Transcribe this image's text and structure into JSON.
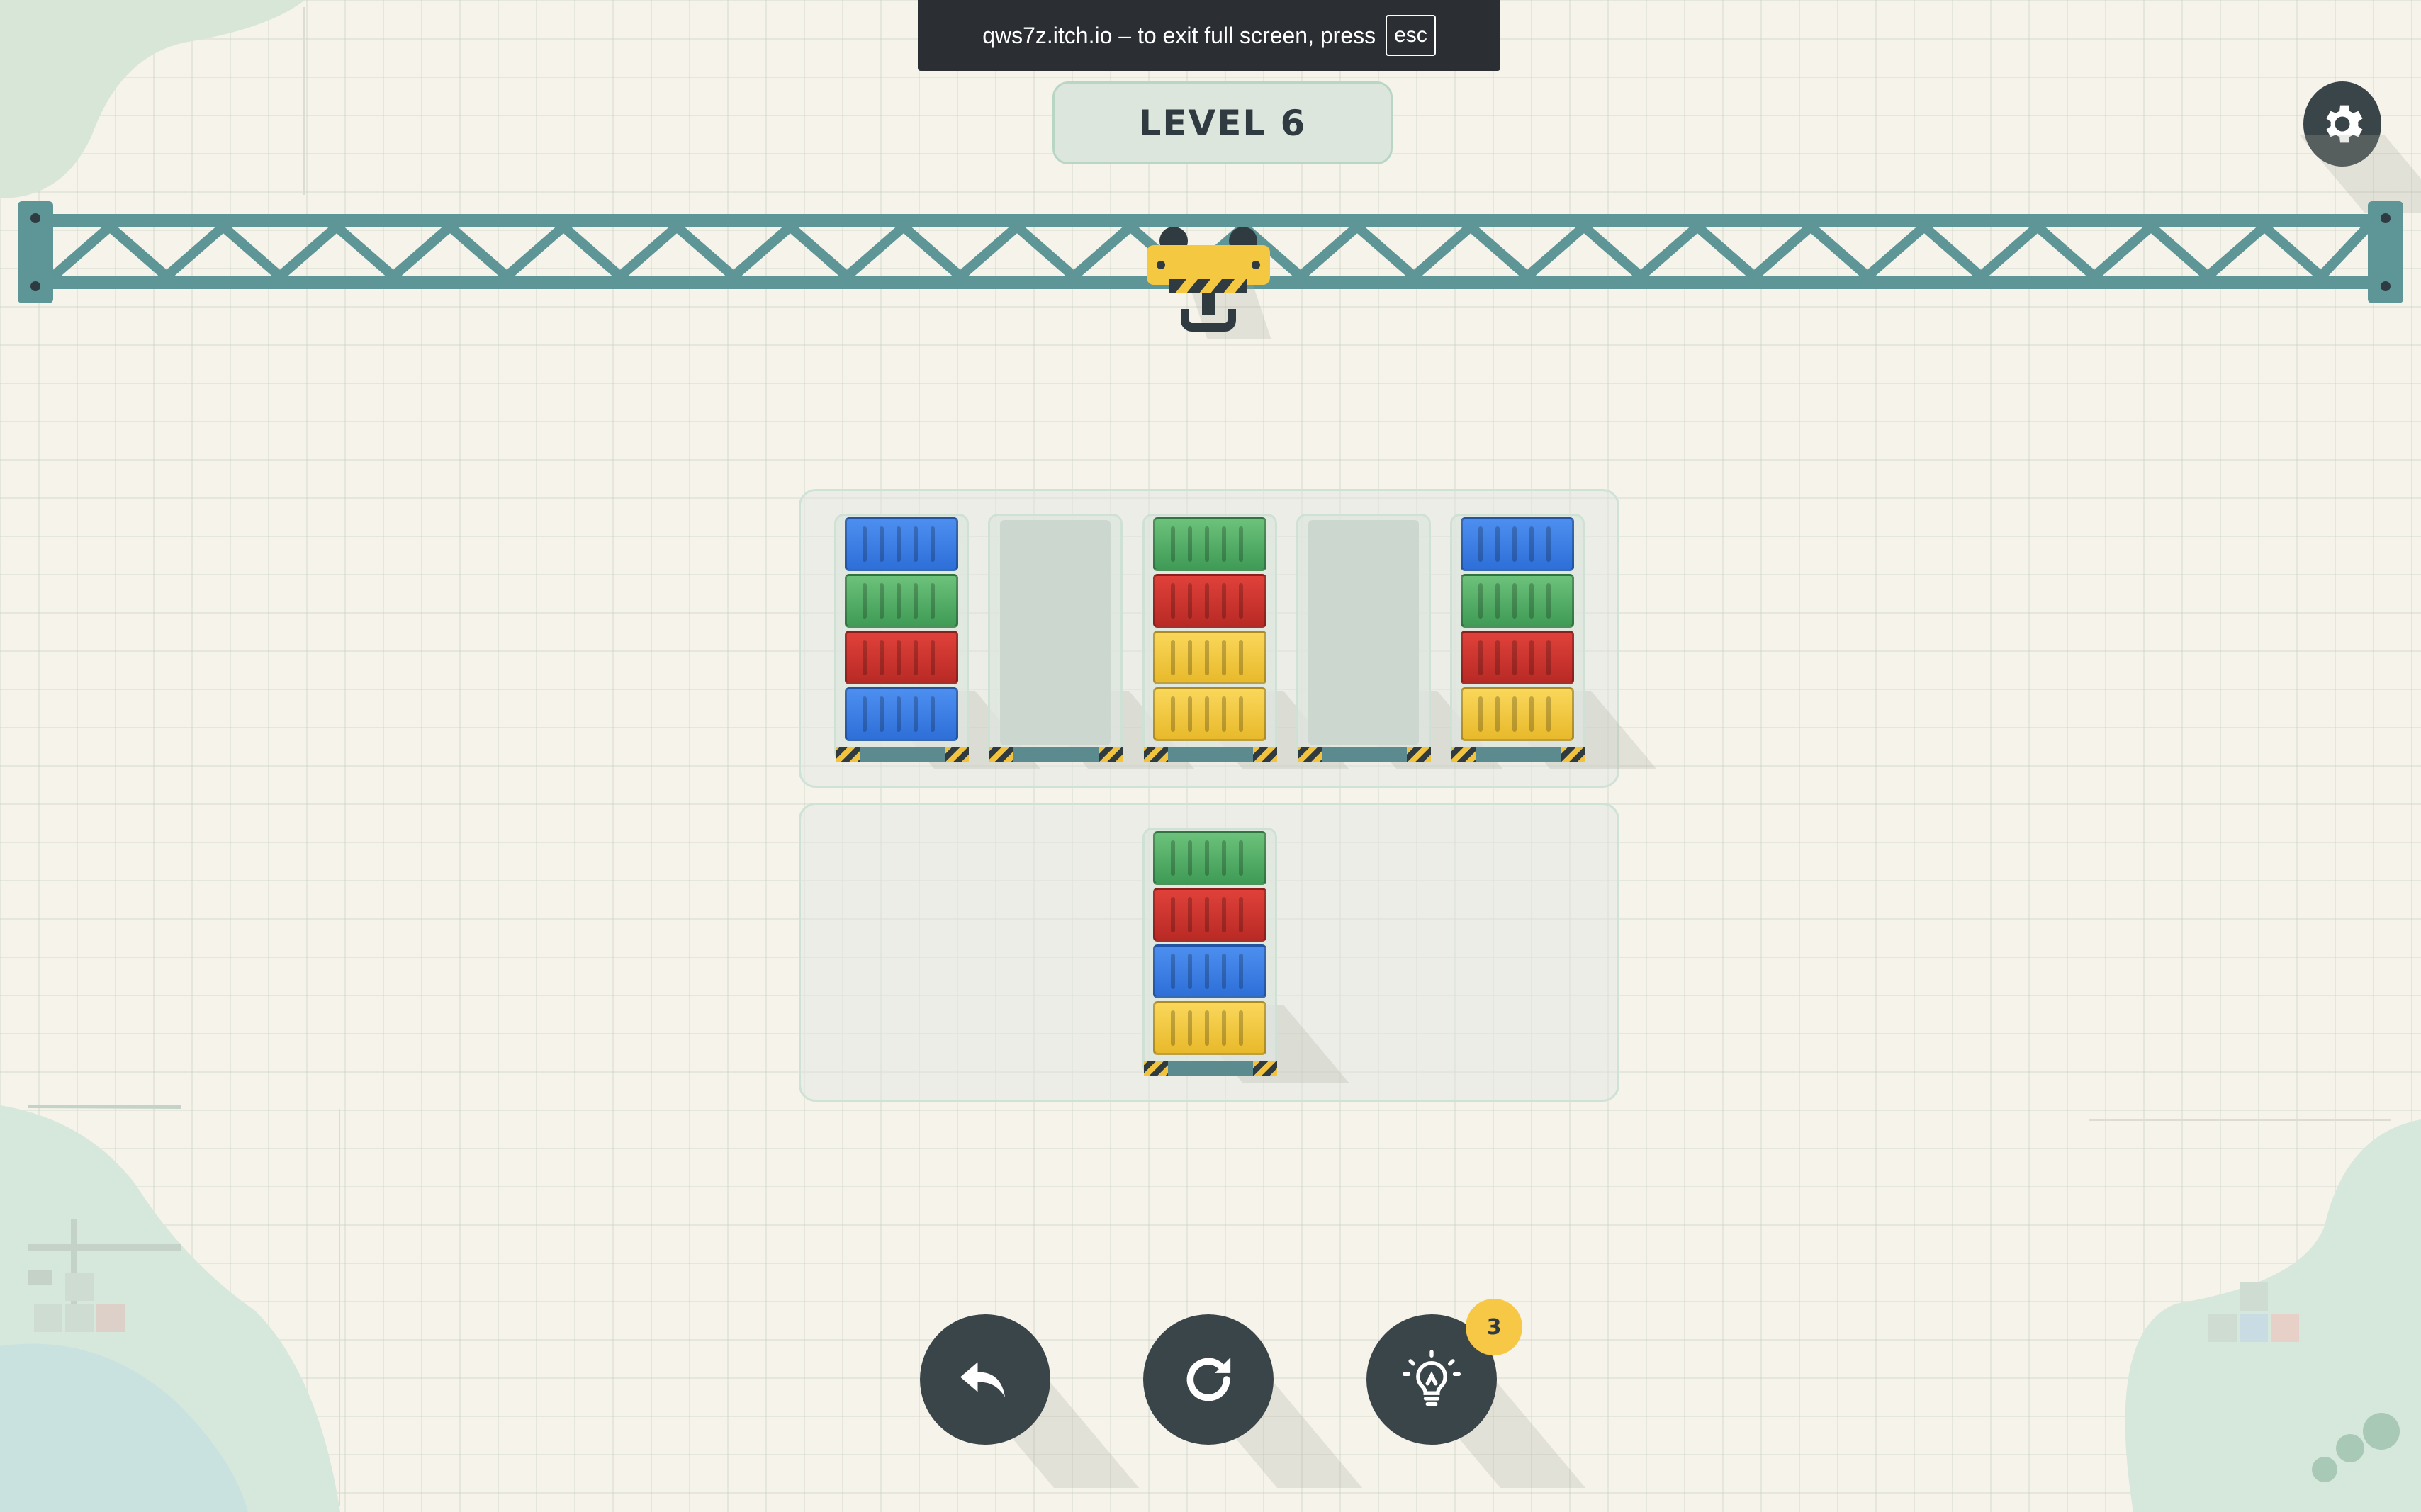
{
  "banner": {
    "text": "qws7z.itch.io – to exit full screen, press",
    "key": "esc"
  },
  "header": {
    "level_label": "LEVEL 6"
  },
  "icons": {
    "settings": "gear-icon",
    "undo": "undo-arrow-icon",
    "restart": "restart-icon",
    "hint": "lightbulb-icon"
  },
  "hint_count": "3",
  "colors": {
    "blue": "#3a7fe6",
    "green": "#52ae66",
    "red": "#cf3530",
    "yellow": "#f2c843",
    "crane": "#5e9597",
    "hook": "#f5c842"
  },
  "board": {
    "top_stacks": [
      [
        "blue",
        "green",
        "red",
        "blue"
      ],
      [],
      [
        "green",
        "red",
        "yellow",
        "yellow"
      ],
      [],
      [
        "blue",
        "green",
        "red",
        "yellow"
      ]
    ],
    "bottom_stacks": [
      [
        "green",
        "red",
        "blue",
        "yellow"
      ]
    ]
  }
}
